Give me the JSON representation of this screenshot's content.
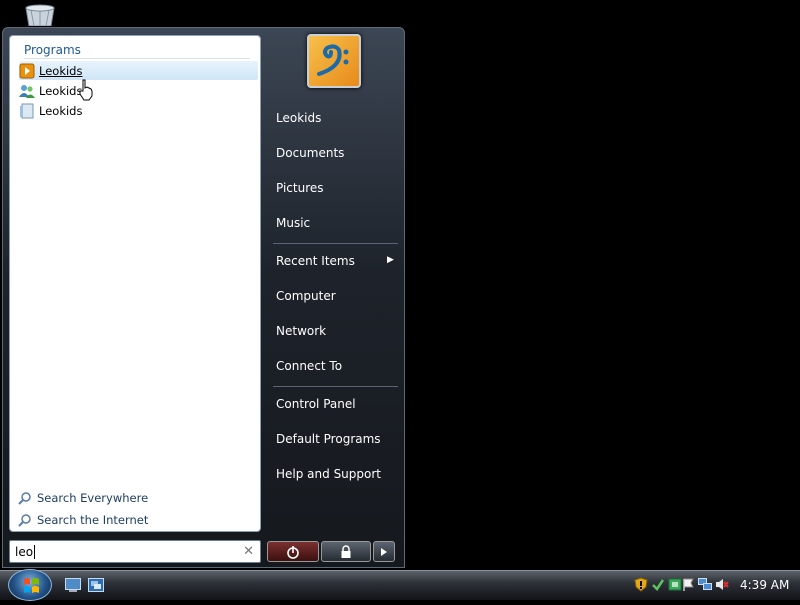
{
  "start_menu": {
    "programs_header": "Programs",
    "programs": [
      {
        "label": "Leokids",
        "icon": "media-player-icon"
      },
      {
        "label": "Leokids",
        "icon": "users-icon"
      },
      {
        "label": "Leokids",
        "icon": "document-icon"
      }
    ],
    "search_links": [
      {
        "label": "Search Everywhere"
      },
      {
        "label": "Search the Internet"
      }
    ],
    "search_value": "leo",
    "right_items": [
      "Leokids",
      "Documents",
      "Pictures",
      "Music",
      "Recent Items",
      "Computer",
      "Network",
      "Connect To",
      "Control Panel",
      "Default Programs",
      "Help and Support"
    ]
  },
  "taskbar": {
    "clock": "4:39 AM"
  },
  "colors": {
    "link_blue": "#1d5a93",
    "hover_highlight": "#cfe6f8",
    "menu_dark": "#1e232b"
  }
}
